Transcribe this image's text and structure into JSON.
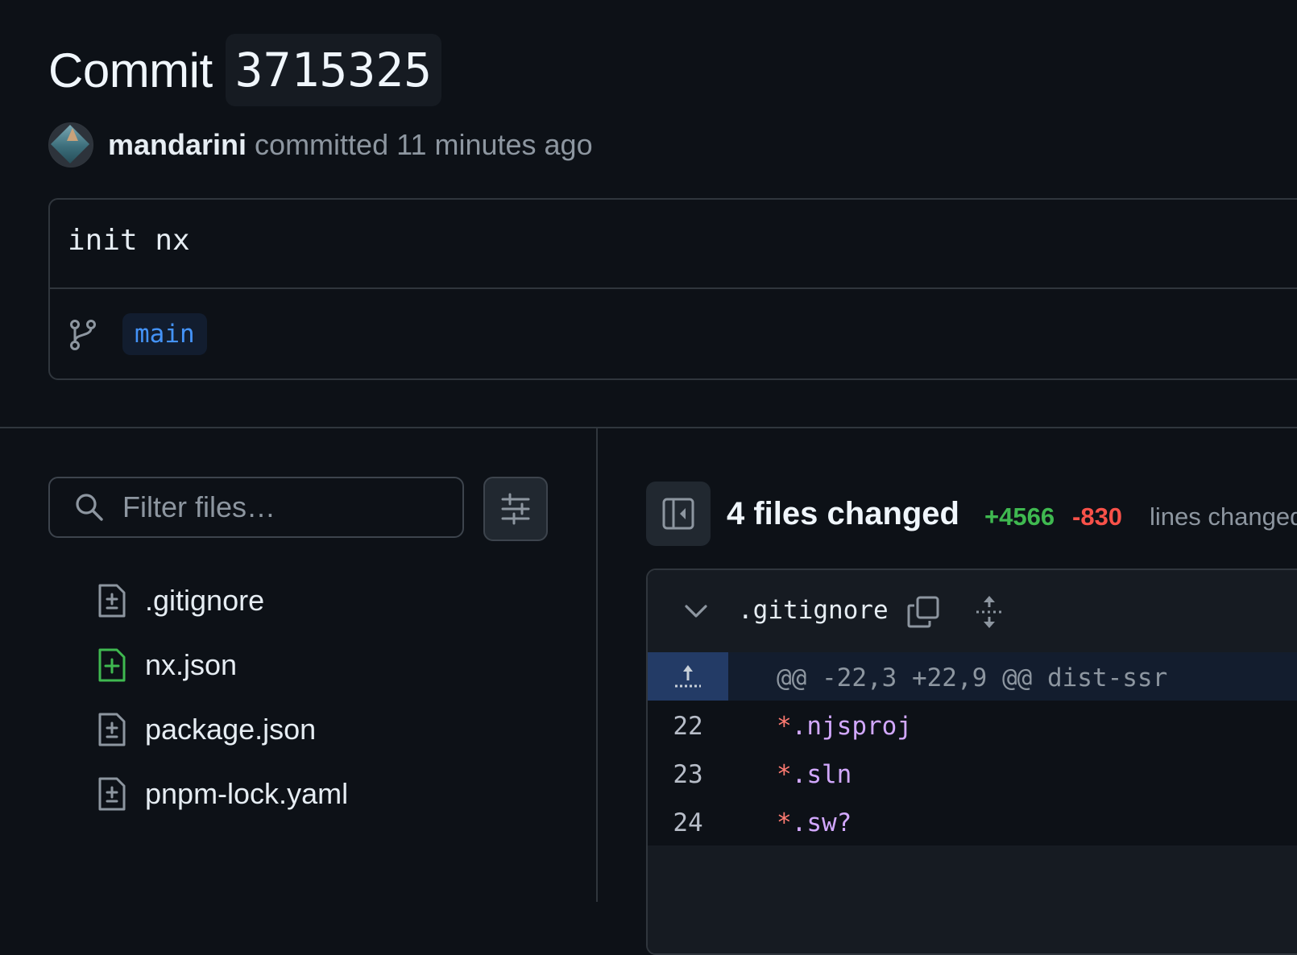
{
  "commit": {
    "title_word": "Commit",
    "sha": "3715325",
    "author": "mandarini",
    "committed_text": "committed 11 minutes ago",
    "message": "init nx",
    "branch": "main"
  },
  "file_tree": {
    "filter_placeholder": "Filter files…",
    "files": [
      {
        "name": ".gitignore",
        "status": "modified",
        "icon": "file-diff-icon"
      },
      {
        "name": "nx.json",
        "status": "added",
        "icon": "file-added-icon"
      },
      {
        "name": "package.json",
        "status": "modified",
        "icon": "file-diff-icon"
      },
      {
        "name": "pnpm-lock.yaml",
        "status": "modified",
        "icon": "file-diff-icon"
      }
    ]
  },
  "summary": {
    "files_changed": "4 files changed",
    "additions": "+4566",
    "deletions": "-830",
    "lines_changed_label": "lines changed"
  },
  "diff": {
    "filename": ".gitignore",
    "hunk_header": "@@ -22,3 +22,9 @@ dist-ssr",
    "lines": [
      {
        "num": "22",
        "star": "*",
        "rest": ".njsproj"
      },
      {
        "num": "23",
        "star": "*",
        "rest": ".sln"
      },
      {
        "num": "24",
        "star": "*",
        "rest": ".sw?"
      }
    ]
  },
  "colors": {
    "background": "#0d1117",
    "additions": "#3fb950",
    "deletions": "#f85149",
    "branch_link": "#4493f8"
  }
}
